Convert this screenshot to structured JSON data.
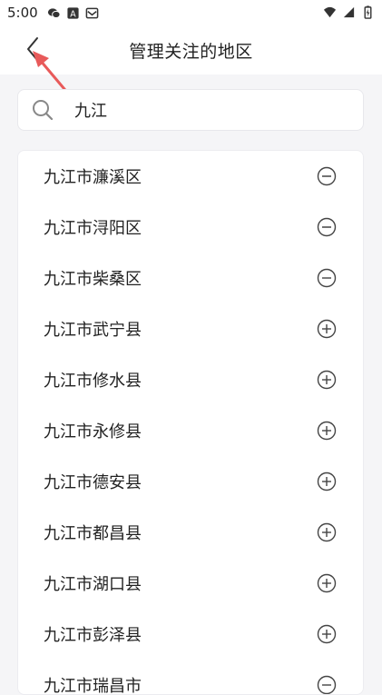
{
  "status_bar": {
    "time": "5:00",
    "left_icons": [
      "wechat-icon",
      "app-a-icon",
      "mail-icon"
    ],
    "right_icons": [
      "wifi-icon",
      "signal-icon",
      "battery-icon"
    ]
  },
  "header": {
    "title": "管理关注的地区",
    "back_icon": "chevron-left-icon"
  },
  "search": {
    "value": "九江",
    "placeholder": ""
  },
  "regions": [
    {
      "name": "九江市濂溪区",
      "action": "remove"
    },
    {
      "name": "九江市浔阳区",
      "action": "remove"
    },
    {
      "name": "九江市柴桑区",
      "action": "remove"
    },
    {
      "name": "九江市武宁县",
      "action": "add"
    },
    {
      "name": "九江市修水县",
      "action": "add"
    },
    {
      "name": "九江市永修县",
      "action": "add"
    },
    {
      "name": "九江市德安县",
      "action": "add"
    },
    {
      "name": "九江市都昌县",
      "action": "add"
    },
    {
      "name": "九江市湖口县",
      "action": "add"
    },
    {
      "name": "九江市彭泽县",
      "action": "add"
    },
    {
      "name": "九江市瑞昌市",
      "action": "remove"
    }
  ],
  "colors": {
    "accent_annotation": "#e85a5a",
    "icon_gray": "#444444",
    "background": "#f5f5f7"
  }
}
